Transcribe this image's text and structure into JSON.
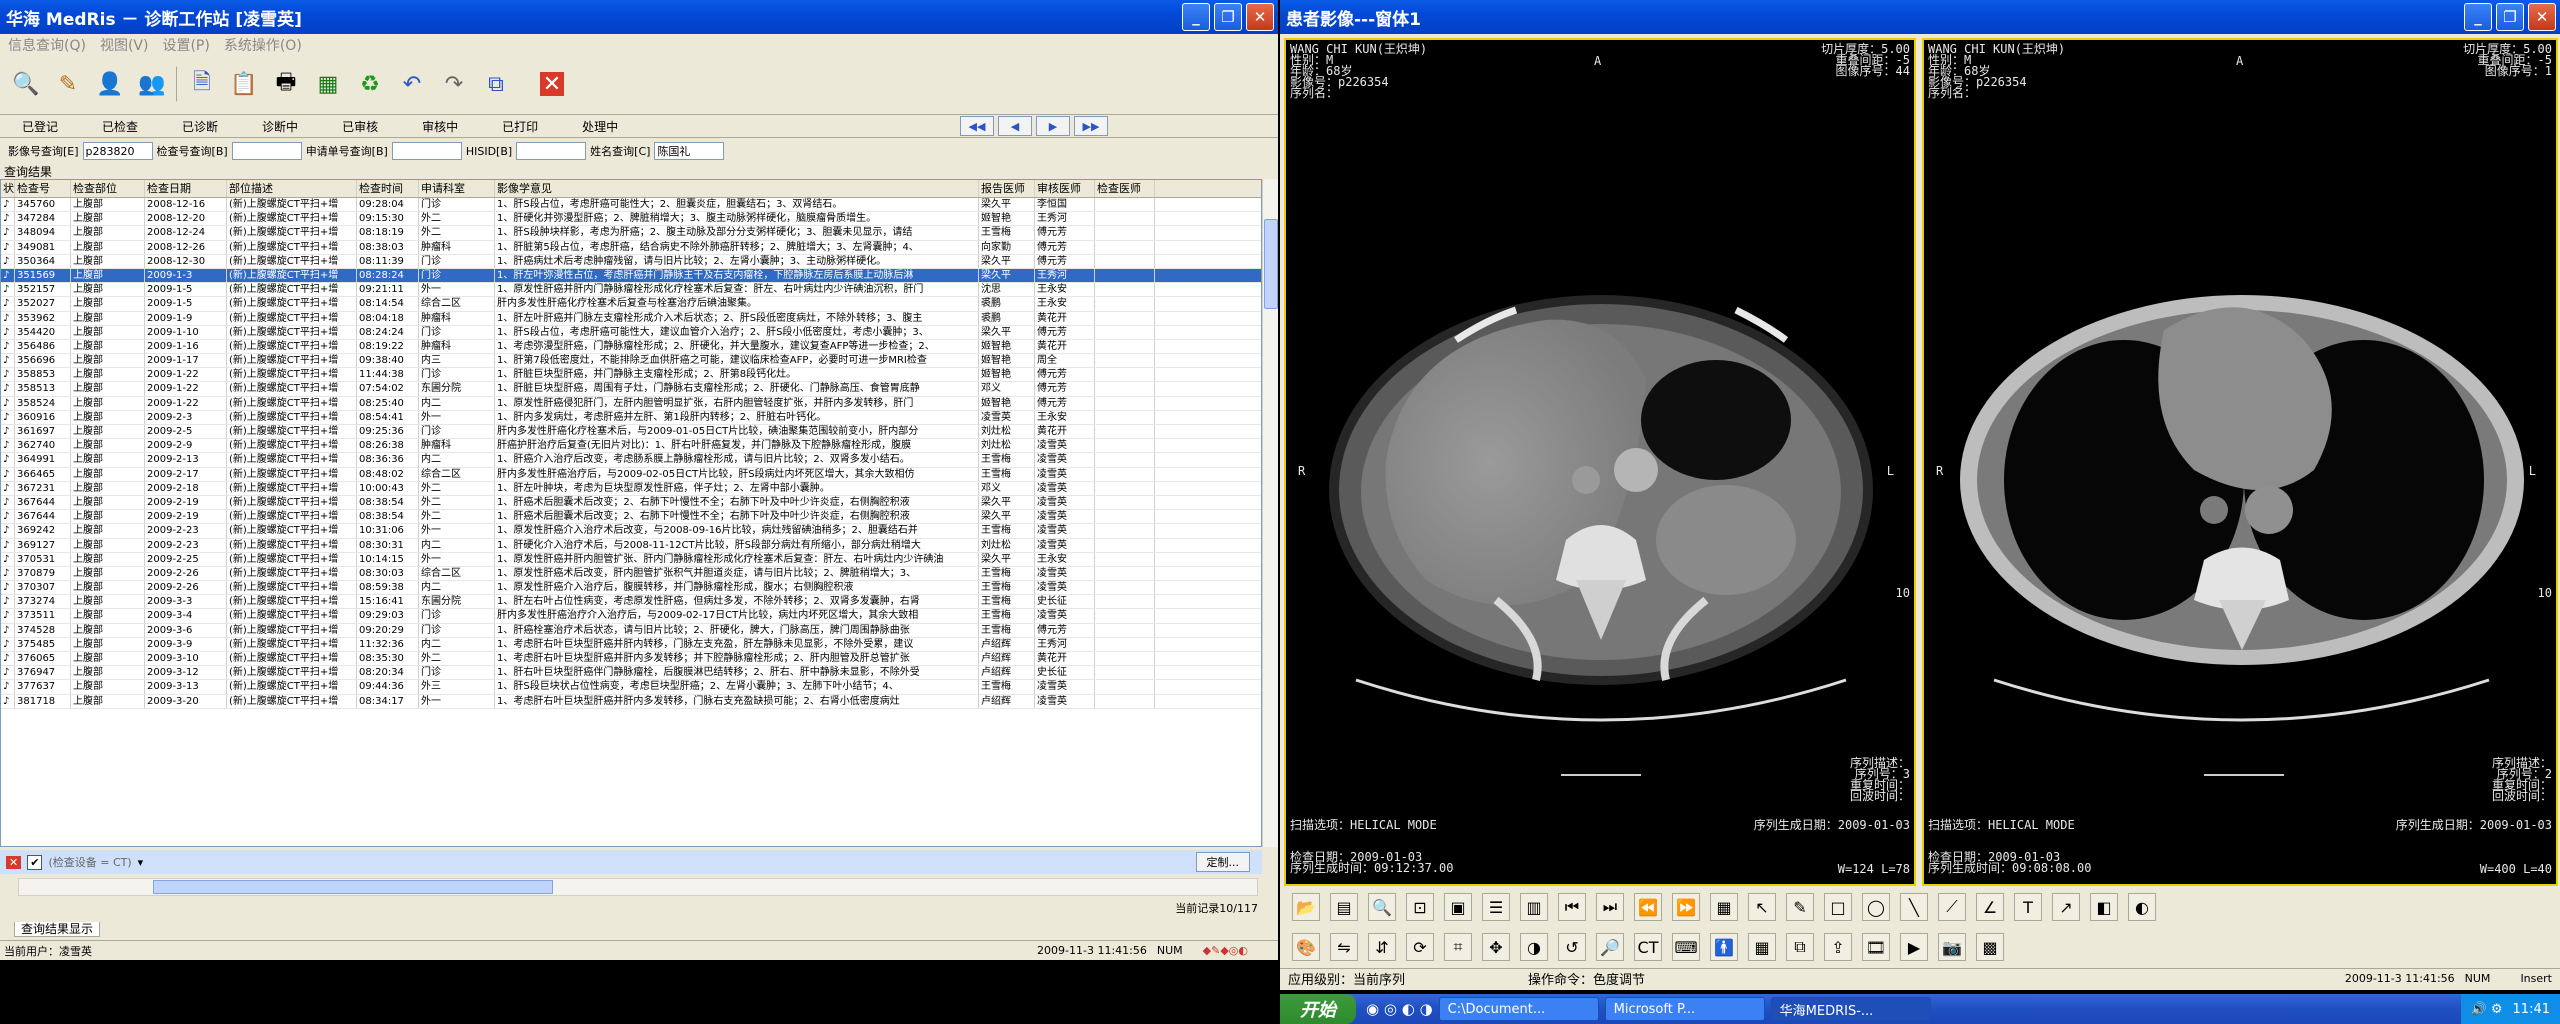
{
  "left": {
    "title": "华海 MedRis － 诊断工作站 [凌雪英]",
    "menu": [
      "信息查询(Q)",
      "视图(V)",
      "设置(P)",
      "系统操作(O)"
    ],
    "status_tabs": [
      "已登记",
      "已检查",
      "已诊断",
      "诊断中",
      "已审核",
      "审核中",
      "已打印",
      "处理中"
    ],
    "search": {
      "l1": "影像号查询[E]",
      "v1": "p283820",
      "l2": "检查号查询[B]",
      "l3": "申请单号查询[B]",
      "l4": "HISID[B]",
      "l5": "姓名查询[C]",
      "v5": "陈国礼"
    },
    "results_title": "查询结果",
    "columns": [
      "状",
      "检查号",
      "检查部位",
      "检查日期",
      "部位描述",
      "检查时间",
      "申请科室",
      "影像学意见",
      "报告医师",
      "审核医师",
      "检查医师"
    ],
    "rows": [
      [
        "345760",
        "上腹部",
        "2008-12-16",
        "(新)上腹螺旋CT平扫+增",
        "09:28:04",
        "门诊",
        "1、肝S段占位，考虑肝癌可能性大；2、胆囊炎症，胆囊结石；3、双肾结石。",
        "梁久平",
        "李恒国"
      ],
      [
        "347284",
        "上腹部",
        "2008-12-20",
        "(新)上腹螺旋CT平扫+增",
        "09:15:30",
        "外二",
        "1、肝硬化并弥漫型肝癌；2、脾脏稍增大；3、腹主动脉粥样硬化，脑膜瘤骨质增生。",
        "姬智艳",
        "王秀河"
      ],
      [
        "348094",
        "上腹部",
        "2008-12-24",
        "(新)上腹螺旋CT平扫+增",
        "08:18:19",
        "外二",
        "1、肝S段肿块样影，考虑为肝癌；2、腹主动脉及部分分支粥样硬化；3、胆囊未见显示，请结",
        "王雪梅",
        "傅元芳"
      ],
      [
        "349081",
        "上腹部",
        "2008-12-26",
        "(新)上腹螺旋CT平扫+增",
        "08:38:03",
        "肿瘤科",
        "1、肝脏第5段占位，考虑肝癌，结合病史不除外肺癌肝转移；2、脾脏增大；3、左肾囊肿；4、",
        "向家勤",
        "傅元芳"
      ],
      [
        "350364",
        "上腹部",
        "2008-12-30",
        "(新)上腹螺旋CT平扫+增",
        "08:11:39",
        "门诊",
        "1、肝癌病灶术后考虑肿瘤残留，请与旧片比较；2、左肾小囊肿；3、主动脉粥样硬化。",
        "梁久平",
        "傅元芳"
      ],
      [
        "351569",
        "上腹部",
        "2009-1-3",
        "(新)上腹螺旋CT平扫+增",
        "08:28:24",
        "门诊",
        "1、肝左叶弥漫性占位，考虑肝癌并门静脉主干及右支内瘤栓，下腔静脉左房后系膜上动脉后淋",
        "梁久平",
        "王秀河"
      ],
      [
        "352157",
        "上腹部",
        "2009-1-5",
        "(新)上腹螺旋CT平扫+增",
        "09:21:11",
        "外一",
        "1、原发性肝癌并肝内门静脉瘤栓形成化疗栓塞术后复查：肝左、右叶病灶内少许碘油沉积，肝门",
        "沈思",
        "王永安"
      ],
      [
        "352027",
        "上腹部",
        "2009-1-5",
        "(新)上腹螺旋CT平扫+增",
        "08:14:54",
        "综合二区",
        "肝内多发性肝癌化疗栓塞术后复查与栓塞治疗后碘油聚集。",
        "裘鹏",
        "王永安"
      ],
      [
        "353962",
        "上腹部",
        "2009-1-9",
        "(新)上腹螺旋CT平扫+增",
        "08:04:18",
        "肿瘤科",
        "1、肝左叶肝癌并门脉左支瘤栓形成介入术后状态；2、肝S段低密度病灶，不除外转移；3、腹主",
        "裘鹏",
        "黄花开"
      ],
      [
        "354420",
        "上腹部",
        "2009-1-10",
        "(新)上腹螺旋CT平扫+增",
        "08:24:24",
        "门诊",
        "1、肝S段占位，考虑肝癌可能性大，建议血管介入治疗；2、肝S段小低密度灶，考虑小囊肿；3、",
        "梁久平",
        "傅元芳"
      ],
      [
        "356486",
        "上腹部",
        "2009-1-16",
        "(新)上腹螺旋CT平扫+增",
        "08:19:22",
        "肿瘤科",
        "1、考虑弥漫型肝癌，门静脉瘤栓形成；2、肝硬化，并大量腹水，建议复查AFP等进一步检查；2、",
        "姬智艳",
        "黄花开"
      ],
      [
        "356696",
        "上腹部",
        "2009-1-17",
        "(新)上腹螺旋CT平扫+增",
        "09:38:40",
        "内三",
        "1、肝第7段低密度灶，不能排除乏血供肝癌之可能，建议临床检查AFP，必要时可进一步MRI检查",
        "姬智艳",
        "周全"
      ],
      [
        "358853",
        "上腹部",
        "2009-1-22",
        "(新)上腹螺旋CT平扫+增",
        "11:44:38",
        "门诊",
        "1、肝脏巨块型肝癌，并门静脉主支瘤栓形成；2、肝第8段钙化灶。",
        "姬智艳",
        "傅元芳"
      ],
      [
        "358513",
        "上腹部",
        "2009-1-22",
        "(新)上腹螺旋CT平扫+增",
        "07:54:02",
        "东圃分院",
        "1、肝脏巨块型肝癌，周围有子灶，门静脉右支瘤栓形成；2、肝硬化、门静脉高压、食管胃底静",
        "邓义",
        "傅元芳"
      ],
      [
        "358524",
        "上腹部",
        "2009-1-22",
        "(新)上腹螺旋CT平扫+增",
        "08:25:40",
        "内二",
        "1、原发性肝癌侵犯肝门，左肝内胆管明显扩张，右肝内胆管轻度扩张，并肝内多发转移，肝门",
        "姬智艳",
        "傅元芳"
      ],
      [
        "360916",
        "上腹部",
        "2009-2-3",
        "(新)上腹螺旋CT平扫+增",
        "08:54:41",
        "外一",
        "1、肝内多发病灶，考虑肝癌并左肝、第1段肝内转移；2、肝脏右叶钙化。",
        "凌雪英",
        "王永安"
      ],
      [
        "361697",
        "上腹部",
        "2009-2-5",
        "(新)上腹螺旋CT平扫+增",
        "09:25:36",
        "门诊",
        "肝内多发性肝癌化疗栓塞术后，与2009-01-05日CT片比较，碘油聚集范围较前变小，肝内部分",
        "刘灶松",
        "黄花开"
      ],
      [
        "362740",
        "上腹部",
        "2009-2-9",
        "(新)上腹螺旋CT平扫+增",
        "08:26:38",
        "肿瘤科",
        "肝癌护肝治疗后复查(无旧片对比)：1、肝右叶肝癌复发，并门静脉及下腔静脉瘤栓形成，腹膜",
        "刘灶松",
        "凌雪英"
      ],
      [
        "364991",
        "上腹部",
        "2009-2-13",
        "(新)上腹螺旋CT平扫+增",
        "08:36:36",
        "内二",
        "1、肝癌介入治疗后改变，考虑肠系膜上静脉瘤栓形成，请与旧片比较；2、双肾多发小结石。",
        "王雪梅",
        "凌雪英"
      ],
      [
        "366465",
        "上腹部",
        "2009-2-17",
        "(新)上腹螺旋CT平扫+增",
        "08:48:02",
        "综合二区",
        "肝内多发性肝癌治疗后，与2009-02-05日CT片比较，肝S段病灶内坏死区增大，其余大致相仿",
        "王雪梅",
        "凌雪英"
      ],
      [
        "367231",
        "上腹部",
        "2009-2-18",
        "(新)上腹螺旋CT平扫+增",
        "10:00:43",
        "外二",
        "1、肝左叶肿块，考虑为巨块型原发性肝癌，伴子灶；2、左肾中部小囊肿。",
        "邓义",
        "凌雪英"
      ],
      [
        "367644",
        "上腹部",
        "2009-2-19",
        "(新)上腹螺旋CT平扫+增",
        "08:38:54",
        "外二",
        "1、肝癌术后胆囊术后改变；2、右肺下叶慢性不全；右肺下叶及中叶少许炎症，右侧胸腔积液",
        "梁久平",
        "凌雪英"
      ],
      [
        "367644",
        "上腹部",
        "2009-2-19",
        "(新)上腹螺旋CT平扫+增",
        "08:38:54",
        "外二",
        "1、肝癌术后胆囊术后改变；2、右肺下叶慢性不全；右肺下叶及中叶少许炎症，右侧胸腔积液",
        "梁久平",
        "凌雪英"
      ],
      [
        "369242",
        "上腹部",
        "2009-2-23",
        "(新)上腹螺旋CT平扫+增",
        "10:31:06",
        "外一",
        "1、原发性肝癌介入治疗术后改变，与2008-09-16片比较，病灶残留碘油稍多；2、胆囊结石并",
        "王雪梅",
        "凌雪英"
      ],
      [
        "369127",
        "上腹部",
        "2009-2-23",
        "(新)上腹螺旋CT平扫+增",
        "08:30:31",
        "内二",
        "1、肝硬化介入治疗术后，与2008-11-12CT片比较，肝S段部分病灶有所缩小，部分病灶稍增大",
        "刘灶松",
        "凌雪英"
      ],
      [
        "370531",
        "上腹部",
        "2009-2-25",
        "(新)上腹螺旋CT平扫+增",
        "10:14:15",
        "外一",
        "1、原发性肝癌并肝内胆管扩张、肝内门静脉瘤栓形成化疗栓塞术后复查：肝左、右叶病灶内少许碘油",
        "梁久平",
        "王永安"
      ],
      [
        "370879",
        "上腹部",
        "2009-2-26",
        "(新)上腹螺旋CT平扫+增",
        "08:30:03",
        "综合二区",
        "1、原发性肝癌术后改变，肝内胆管扩张积气并胆道炎症，请与旧片比较；2、脾脏稍增大；3、",
        "王雪梅",
        "凌雪英"
      ],
      [
        "370307",
        "上腹部",
        "2009-2-26",
        "(新)上腹螺旋CT平扫+增",
        "08:59:38",
        "内二",
        "1、原发性肝癌介入治疗后，腹膜转移，并门静脉瘤栓形成，腹水；右侧胸腔积液",
        "王雪梅",
        "凌雪英"
      ],
      [
        "373274",
        "上腹部",
        "2009-3-3",
        "(新)上腹螺旋CT平扫+增",
        "15:16:41",
        "东圃分院",
        "1、肝左右叶占位性病变，考虑原发性肝癌，但病灶多发，不除外转移；2、双肾多发囊肿，右肾",
        "王雪梅",
        "史长征"
      ],
      [
        "373511",
        "上腹部",
        "2009-3-4",
        "(新)上腹螺旋CT平扫+增",
        "09:29:03",
        "门诊",
        "肝内多发性肝癌治疗介入治疗后，与2009-02-17日CT片比较，病灶内坏死区增大，其余大致相",
        "王雪梅",
        "凌雪英"
      ],
      [
        "374528",
        "上腹部",
        "2009-3-6",
        "(新)上腹螺旋CT平扫+增",
        "09:20:29",
        "门诊",
        "1、肝癌栓塞治疗术后状态，请与旧片比较；2、肝硬化，脾大，门脉高压，脾门周围静脉曲张",
        "王雪梅",
        "傅元芳"
      ],
      [
        "375485",
        "上腹部",
        "2009-3-9",
        "(新)上腹螺旋CT平扫+增",
        "11:32:36",
        "内二",
        "1、考虑肝右叶巨块型肝癌并肝内转移，门脉左支充盈，肝左静脉未见显影，不除外受累，建议",
        "卢绍辉",
        "王秀河"
      ],
      [
        "376065",
        "上腹部",
        "2009-3-10",
        "(新)上腹螺旋CT平扫+增",
        "08:35:30",
        "外二",
        "1、考虑肝右叶巨块型肝癌并肝内多发转移；并下腔静脉瘤栓形成；2、肝内胆管及肝总管扩张",
        "卢绍辉",
        "黄花开"
      ],
      [
        "376947",
        "上腹部",
        "2009-3-12",
        "(新)上腹螺旋CT平扫+增",
        "08:20:34",
        "门诊",
        "1、肝右叶巨块型肝癌伴门静脉瘤栓，后腹膜淋巴结转移；2、肝右、肝中静脉未显影，不除外受",
        "卢绍辉",
        "史长征"
      ],
      [
        "377637",
        "上腹部",
        "2009-3-13",
        "(新)上腹螺旋CT平扫+增",
        "09:44:36",
        "外三",
        "1、肝S段巨块状占位性病变，考虑巨块型肝癌；2、左肾小囊肿；3、左肺下叶小结节；4、",
        "王雪梅",
        "凌雪英"
      ],
      [
        "381718",
        "上腹部",
        "2009-3-20",
        "(新)上腹螺旋CT平扫+增",
        "08:34:17",
        "外一",
        "1、考虑肝右叶巨块型肝癌并肝内多发转移，门脉右支充盈缺损可能；2、右肾小低密度病灶",
        "卢绍辉",
        "凌雪英"
      ]
    ],
    "filter_label": "(检查设备 = CT)",
    "custom_btn": "定制...",
    "record": "当前记录10/117",
    "bottom_tab": "查询结果显示",
    "statusbar": {
      "user": "当前用户：凌雪英",
      "time": "2009-11-3 11:41:56",
      "num": "NUM"
    }
  },
  "right": {
    "title": "患者影像---窗体1",
    "v1": {
      "name": "WANG CHI KUN(王炽坤)",
      "sex": "性别：M",
      "age": "年龄：68岁",
      "id": "影像号：p226354",
      "series": "序列名：",
      "thick": "切片厚度：5.00",
      "gap": "重叠间距：-5",
      "imgno": "图像序号：44",
      "a": "A",
      "r": "R",
      "l": "L",
      "scan": "扫描选项：HELICAL MODE",
      "sdesc": "序列描述：",
      "sno": "序列号：3",
      "repeat": "重复时间：",
      "echo": "回波时间：",
      "date": "检查日期：2009-01-03",
      "sdate": "序列生成日期：2009-01-03",
      "stime": "序列生成时间：09:12:37.00",
      "wl": "W=124 L=78",
      "marker": "10"
    },
    "v2": {
      "name": "WANG CHI KUN(王炽坤)",
      "sex": "性别：M",
      "age": "年龄：68岁",
      "id": "影像号：p226354",
      "series": "序列名：",
      "thick": "切片厚度：5.00",
      "gap": "重叠间距：-5",
      "imgno": "图像序号：1",
      "a": "A",
      "r": "R",
      "l": "L",
      "scan": "扫描选项：HELICAL MODE",
      "sdesc": "序列描述：",
      "sno": "序列号：2",
      "repeat": "重复时间：",
      "echo": "回波时间：",
      "date": "检查日期：2009-01-03",
      "sdate": "序列生成日期：2009-01-03",
      "stime": "序列生成时间：09:08:08.00",
      "wl": "W=400 L=40",
      "marker": "10"
    },
    "status": {
      "level": "应用级别：当前序列",
      "op": "操作命令：色度调节",
      "time": "2009-11-3 11:41:56",
      "num": "NUM",
      "ins": "Insert"
    }
  },
  "taskbar": {
    "start": "开始",
    "tasks": [
      "C:\\Document...",
      "Microsoft P...",
      "华海MEDRIS-..."
    ],
    "clock": "11:41"
  }
}
